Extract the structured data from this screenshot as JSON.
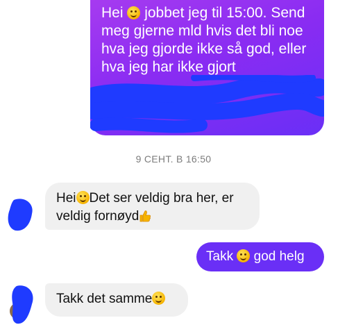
{
  "messages": {
    "outgoing_1": {
      "lines": [
        "Hei",
        "jobbet jeg til 15:00. Send",
        "meg gjerne mld hvis det bli noe",
        "hva jeg gjorde ikke så god, eller",
        "hva jeg har ikke gjort"
      ]
    },
    "timestamp": "9 СЕНТ. В 16:50",
    "incoming_1": {
      "line1_a": "Hei",
      "line1_b": "Det ser veldig bra her, er",
      "line2": "veldig fornøyd"
    },
    "outgoing_2": {
      "text_a": "Takk",
      "text_b": "god helg"
    },
    "incoming_2": {
      "text": "Takk det samme"
    }
  },
  "colors": {
    "outgoing_bubble": "#8a2cf2",
    "incoming_bubble": "#f0f0f0",
    "redaction": "#1f3bff"
  },
  "icons": [
    "smiling-face-emoji",
    "blush-emoji",
    "thumbs-up-emoji"
  ]
}
